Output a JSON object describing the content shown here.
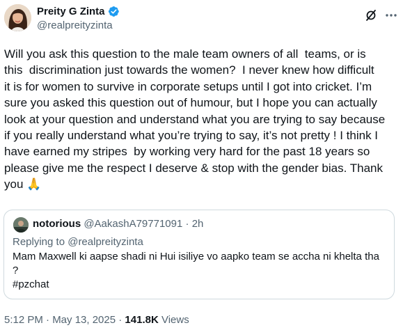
{
  "post": {
    "author": {
      "display_name": "Preity G Zinta",
      "handle": "@realpreityzinta",
      "verified_icon": "verified-badge-icon",
      "verified_color": "#1d9bf0"
    },
    "actions": {
      "grok_icon": "grok-icon",
      "more_icon": "more-options-icon"
    },
    "text": "Will you ask this question to the male team owners of all  teams, or is\nthis  discrimination just towards the women?  I never knew how difficult\nit is for women to survive in corporate setups until I got into cricket. I’m\nsure you asked this question out of humour, but I hope you can actually\nlook at your question and understand what you are trying to say because\nif you really understand what you’re trying to say, it’s not pretty ! I think I\nhave earned my stripes  by working very hard for the past 18 years so\nplease give me the respect I deserve & stop with the gender bias. Thank\nyou 🙏",
    "quoted": {
      "display_name": "notorious",
      "handle": "@AakashA79771091",
      "separator": " · ",
      "time": "2h",
      "replying_to": "Replying to @realpreityzinta",
      "text": "Mam Maxwell ki aapse shadi ni Hui isiliye vo aapko team se accha ni khelta tha\n?\n#pzchat"
    },
    "footer": {
      "timestamp": "5:12 PM · May 13, 2025 · ",
      "views_count": "141.8K",
      "views_label": " Views"
    }
  }
}
